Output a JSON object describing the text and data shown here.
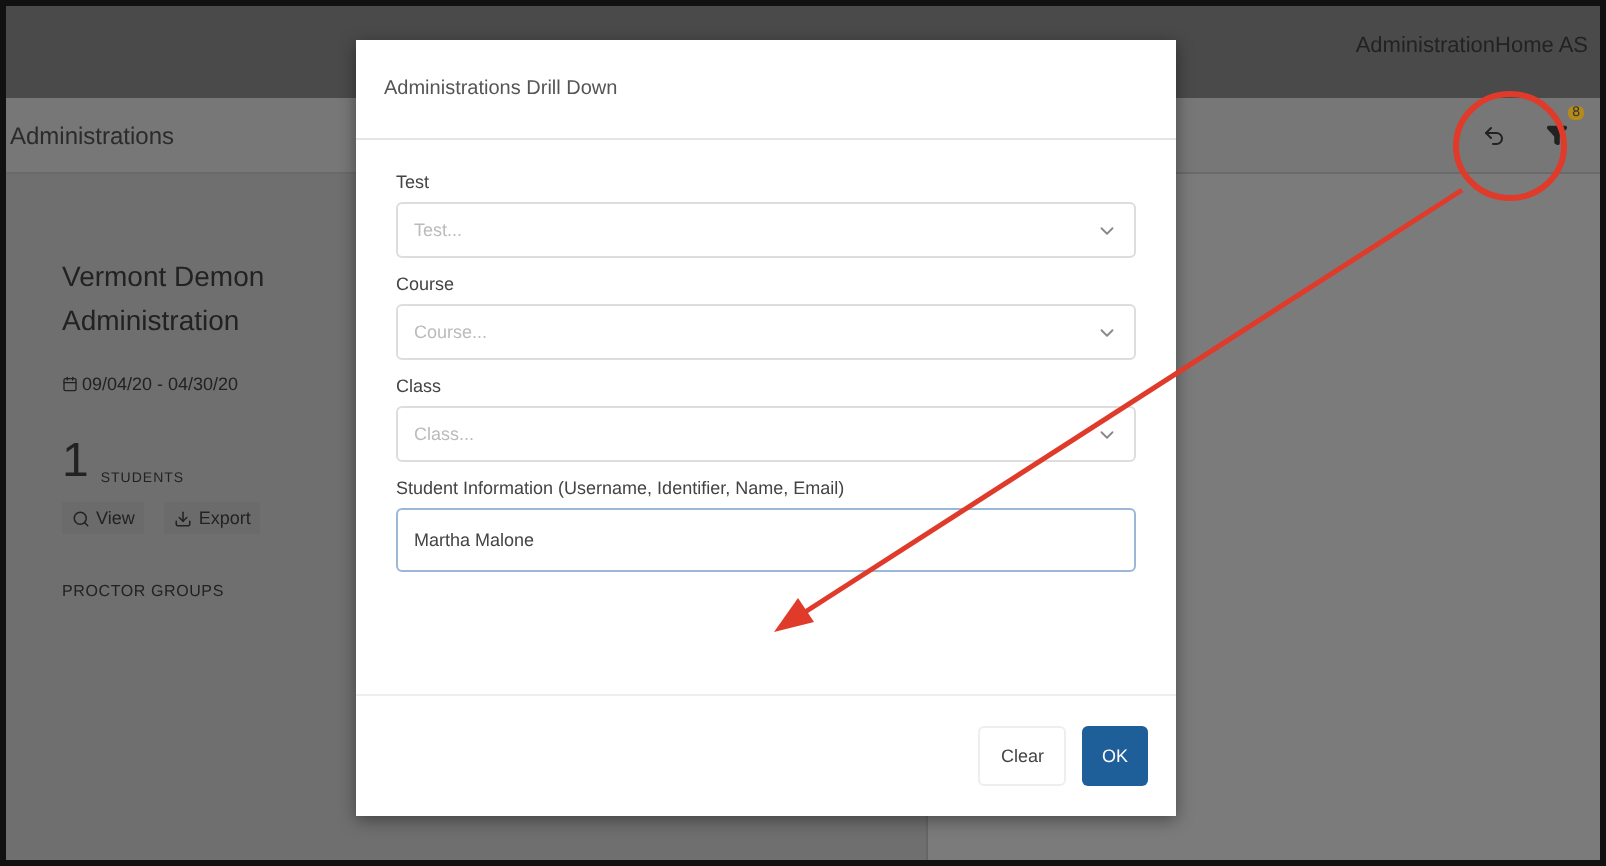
{
  "top_bar": {
    "title": "AdministrationHome AS"
  },
  "page": {
    "title": "Administrations",
    "filter_badge": "8",
    "card": {
      "name_lines": [
        "Vermont Demon",
        "Administration"
      ],
      "dates": "09/04/20 - 04/30/20",
      "count": "1",
      "count_label": "STUDENTS",
      "actions": [
        "View",
        "Export"
      ],
      "section": "PROCTOR GROUPS"
    }
  },
  "dialog": {
    "title": "Administrations Drill Down",
    "fields": [
      {
        "kind": "select",
        "label": "Test",
        "placeholder": "Test..."
      },
      {
        "kind": "select",
        "label": "Course",
        "placeholder": "Course..."
      },
      {
        "kind": "select",
        "label": "Class",
        "placeholder": "Class..."
      },
      {
        "kind": "text",
        "label": "Student Information (Username, Identifier, Name, Email)",
        "value": "Martha Malone"
      }
    ],
    "buttons": [
      {
        "label": "Clear",
        "primary": false
      },
      {
        "label": "OK",
        "primary": true
      }
    ]
  }
}
